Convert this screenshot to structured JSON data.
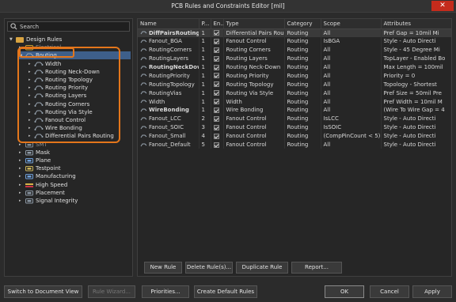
{
  "window": {
    "title": "PCB Rules and Constraints Editor [mil]",
    "close": "✕"
  },
  "search": {
    "placeholder": "Search"
  },
  "tree": [
    {
      "label": "Design Rules",
      "arrow": "▼",
      "level": 0,
      "icon": "rules-folder"
    },
    {
      "label": "Electrical",
      "arrow": "▸",
      "level": 1,
      "icon": "electrical",
      "faded": true
    },
    {
      "label": "Routing",
      "arrow": "◢",
      "level": 1,
      "icon": "routing",
      "selected": true
    },
    {
      "label": "Width",
      "arrow": "▸",
      "level": 2,
      "icon": "rule"
    },
    {
      "label": "Routing Neck-Down",
      "arrow": "▸",
      "level": 2,
      "icon": "rule"
    },
    {
      "label": "Routing Topology",
      "arrow": "▸",
      "level": 2,
      "icon": "rule"
    },
    {
      "label": "Routing Priority",
      "arrow": "▸",
      "level": 2,
      "icon": "rule"
    },
    {
      "label": "Routing Layers",
      "arrow": "▸",
      "level": 2,
      "icon": "rule"
    },
    {
      "label": "Routing Corners",
      "arrow": "▸",
      "level": 2,
      "icon": "rule"
    },
    {
      "label": "Routing Via Style",
      "arrow": "▸",
      "level": 2,
      "icon": "rule"
    },
    {
      "label": "Fanout Control",
      "arrow": "▸",
      "level": 2,
      "icon": "rule"
    },
    {
      "label": "Wire Bonding",
      "arrow": "▸",
      "level": 2,
      "icon": "rule"
    },
    {
      "label": "Differential Pairs Routing",
      "arrow": "▸",
      "level": 2,
      "icon": "rule"
    },
    {
      "label": "SMT",
      "arrow": "▸",
      "level": 1,
      "icon": "smt",
      "faded": true
    },
    {
      "label": "Mask",
      "arrow": "▸",
      "level": 1,
      "icon": "mask"
    },
    {
      "label": "Plane",
      "arrow": "▸",
      "level": 1,
      "icon": "plane"
    },
    {
      "label": "Testpoint",
      "arrow": "▸",
      "level": 1,
      "icon": "testpoint"
    },
    {
      "label": "Manufacturing",
      "arrow": "▸",
      "level": 1,
      "icon": "manufacturing"
    },
    {
      "label": "High Speed",
      "arrow": "▸",
      "level": 1,
      "icon": "high-speed"
    },
    {
      "label": "Placement",
      "arrow": "▸",
      "level": 1,
      "icon": "placement"
    },
    {
      "label": "Signal Integrity",
      "arrow": "▸",
      "level": 1,
      "icon": "signal-integrity"
    }
  ],
  "table": {
    "headers": [
      "Name",
      "P...",
      "En...",
      "Type",
      "Category",
      "Scope",
      "Attributes"
    ],
    "rows": [
      {
        "name": "DiffPairsRouting",
        "priority": "1",
        "enabled": true,
        "type": "Differential Pairs Routi",
        "category": "Routing",
        "scope": "All",
        "attributes": "Pref Gap = 10mil  Mi",
        "bold": true,
        "selected": true
      },
      {
        "name": "Fanout_BGA",
        "priority": "1",
        "enabled": true,
        "type": "Fanout Control",
        "category": "Routing",
        "scope": "IsBGA",
        "attributes": "Style - Auto  Directi"
      },
      {
        "name": "RoutingCorners",
        "priority": "1",
        "enabled": true,
        "type": "Routing Corners",
        "category": "Routing",
        "scope": "All",
        "attributes": "Style - 45 Degree  Mi"
      },
      {
        "name": "RoutingLayers",
        "priority": "1",
        "enabled": true,
        "type": "Routing Layers",
        "category": "Routing",
        "scope": "All",
        "attributes": "TopLayer - Enabled Bo"
      },
      {
        "name": "RoutingNeckDown",
        "priority": "1",
        "enabled": true,
        "type": "Routing Neck-Down",
        "category": "Routing",
        "scope": "All",
        "attributes": "Max Length = 100mil",
        "bold": true
      },
      {
        "name": "RoutingPriority",
        "priority": "1",
        "enabled": true,
        "type": "Routing Priority",
        "category": "Routing",
        "scope": "All",
        "attributes": "Priority = 0"
      },
      {
        "name": "RoutingTopology",
        "priority": "1",
        "enabled": true,
        "type": "Routing Topology",
        "category": "Routing",
        "scope": "All",
        "attributes": "Topology - Shortest"
      },
      {
        "name": "RoutingVias",
        "priority": "1",
        "enabled": true,
        "type": "Routing Via Style",
        "category": "Routing",
        "scope": "All",
        "attributes": "Pref Size = 50mil  Pre"
      },
      {
        "name": "Width",
        "priority": "1",
        "enabled": true,
        "type": "Width",
        "category": "Routing",
        "scope": "All",
        "attributes": "Pref Width = 10mil  M"
      },
      {
        "name": "WireBonding",
        "priority": "1",
        "enabled": true,
        "type": "Wire Bonding",
        "category": "Routing",
        "scope": "All",
        "attributes": "(Wire To Wire Gap = 4",
        "bold": true
      },
      {
        "name": "Fanout_LCC",
        "priority": "2",
        "enabled": true,
        "type": "Fanout Control",
        "category": "Routing",
        "scope": "IsLCC",
        "attributes": "Style - Auto  Directi"
      },
      {
        "name": "Fanout_SOIC",
        "priority": "3",
        "enabled": true,
        "type": "Fanout Control",
        "category": "Routing",
        "scope": "IsSOIC",
        "attributes": "Style - Auto  Directi"
      },
      {
        "name": "Fanout_Small",
        "priority": "4",
        "enabled": true,
        "type": "Fanout Control",
        "category": "Routing",
        "scope": "(CompPinCount < 5)",
        "attributes": "Style - Auto  Directi"
      },
      {
        "name": "Fanout_Default",
        "priority": "5",
        "enabled": true,
        "type": "Fanout Control",
        "category": "Routing",
        "scope": "All",
        "attributes": "Style - Auto  Directi"
      }
    ]
  },
  "panel_buttons": {
    "new_rule": "New Rule",
    "delete_rule": "Delete Rule(s)...",
    "duplicate_rule": "Duplicate Rule",
    "report": "Report..."
  },
  "bottom_buttons": {
    "switch": "Switch to Document View",
    "rule_wizard": "Rule Wizard...",
    "priorities": "Priorities...",
    "create_default": "Create Default Rules",
    "ok": "OK",
    "cancel": "Cancel",
    "apply": "Apply"
  },
  "colors": {
    "accent": "#e4761b",
    "selection": "#3e5f8a",
    "background": "#2b2b2b",
    "close": "#c42b1c"
  }
}
